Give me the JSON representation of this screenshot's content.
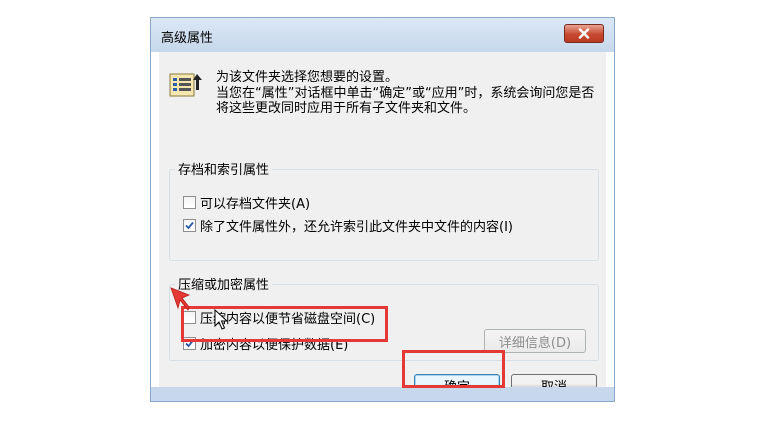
{
  "dialog": {
    "title": "高级属性",
    "description_line1": "为该文件夹选择您想要的设置。",
    "description_line2": "当您在“属性”对话框中单击“确定”或“应用”时，系统会询问您是否将这些更改同时应用于所有子文件夹和文件。"
  },
  "archive_group": {
    "title": "存档和索引属性",
    "options": [
      {
        "label": "可以存档文件夹(A)",
        "checked": false
      },
      {
        "label": "除了文件属性外，还允许索引此文件夹中文件的内容(I)",
        "checked": true
      }
    ]
  },
  "compress_group": {
    "title": "压缩或加密属性",
    "options": [
      {
        "label": "压缩内容以便节省磁盘空间(C)",
        "checked": false
      },
      {
        "label": "加密内容以便保护数据(E)",
        "checked": true
      }
    ],
    "details_button": "详细信息(D)"
  },
  "buttons": {
    "ok": "确定",
    "cancel": "取消"
  },
  "colors": {
    "highlight": "#e53935",
    "close_button": "#c7492f",
    "check_mark": "#2b5ea8"
  }
}
